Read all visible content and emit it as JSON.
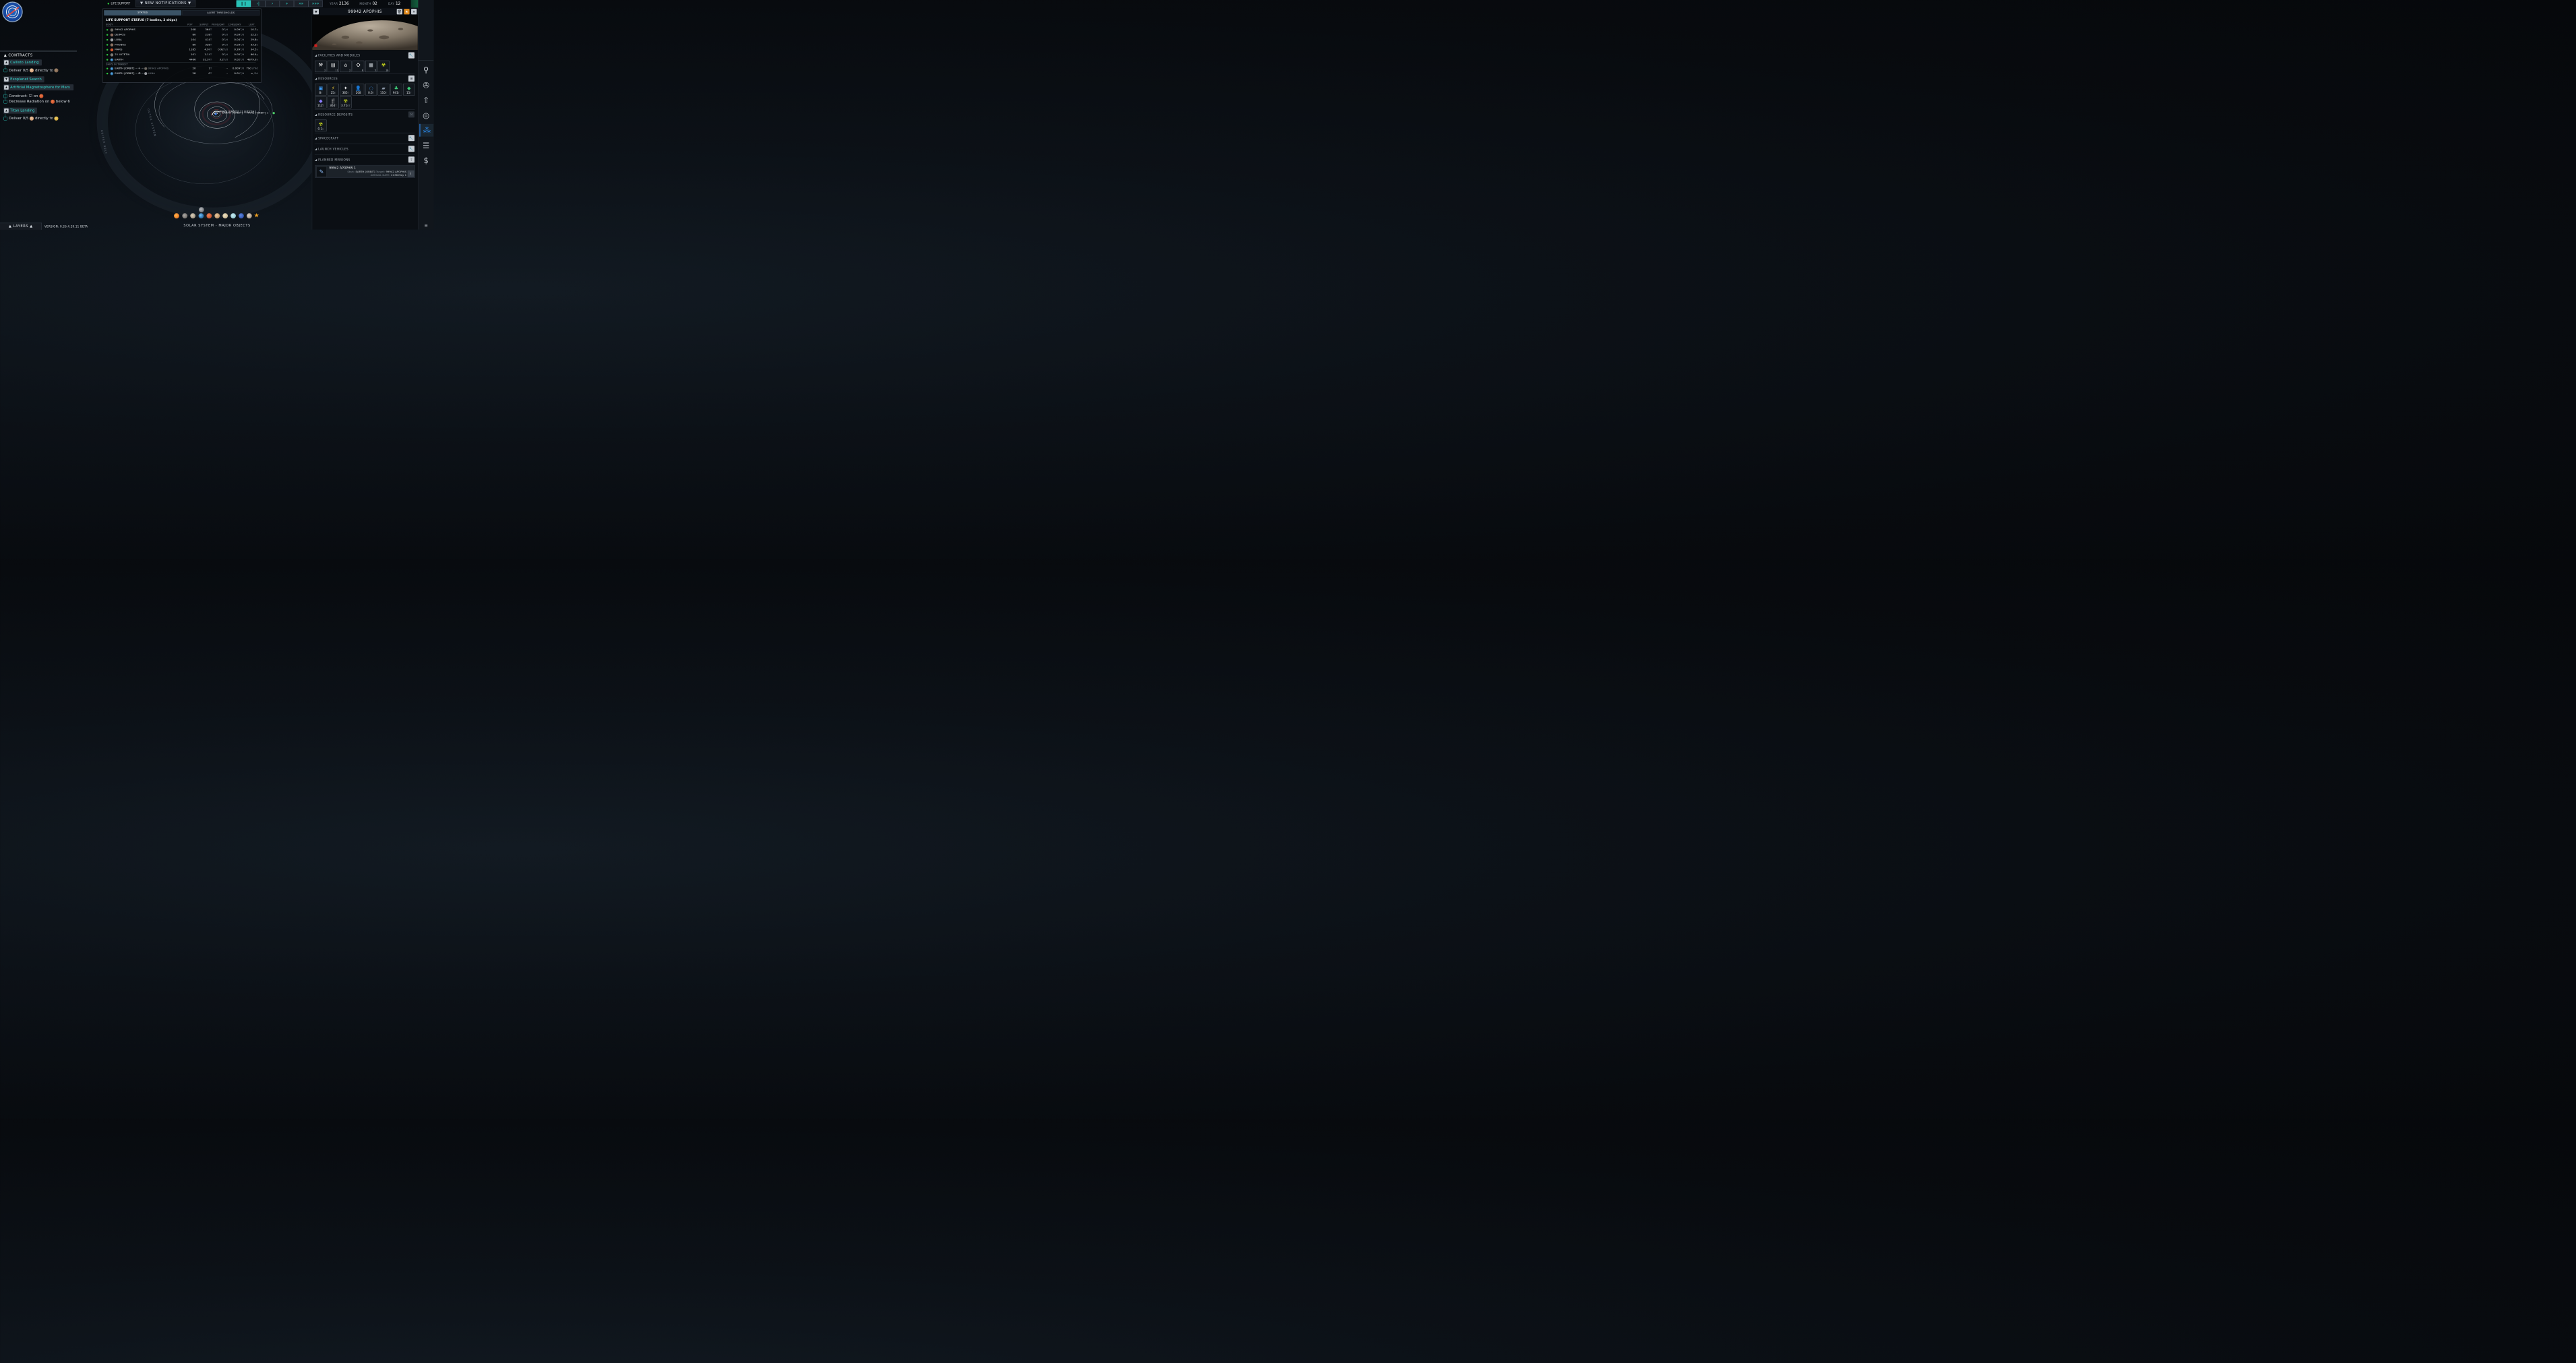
{
  "top_bar": {
    "life_support_label": "LIFE SUPPORT",
    "notifications_label": "▼ NEW NOTIFICATIONS ▼",
    "time_controls": [
      "❙❙",
      "›|",
      "›",
      "»",
      "»»",
      "»»»"
    ],
    "year_label": "YEAR",
    "year": "2136",
    "month_label": "MONTH",
    "month": "02",
    "day_label": "DAY",
    "day": "12",
    "money": "$126M"
  },
  "life_support": {
    "tabs": [
      "STATUS",
      "ALERT THRESHOLDS"
    ],
    "title": "LIFE SUPPORT STATUS  (7 bodies, 2 ships)",
    "columns": [
      "BODY",
      "POP",
      "SUPPLY",
      "PROD/DAY",
      "CONS/DAY",
      "LEFT"
    ],
    "bodies": [
      {
        "name": "99942 APOPHIS",
        "pop": "208",
        "supply": "364",
        "supply_unit": "T",
        "prod": "0",
        "prod_unit": "T/d",
        "cons": "0.09",
        "cons_unit": "T/d",
        "left": "10.7",
        "left_unit": "y"
      },
      {
        "name": "DEIMOS",
        "pop": "80",
        "supply": "218",
        "supply_unit": "T",
        "prod": "0",
        "prod_unit": "T/d",
        "cons": "0.03",
        "cons_unit": "T/d",
        "left": "22.2",
        "left_unit": "y"
      },
      {
        "name": "LUNA",
        "pop": "104",
        "supply": "414",
        "supply_unit": "T",
        "prod": "0",
        "prod_unit": "T/d",
        "cons": "0.04",
        "cons_unit": "T/d",
        "left": "29.8",
        "left_unit": "y"
      },
      {
        "name": "PHOBOS",
        "pop": "80",
        "supply": "328",
        "supply_unit": "T",
        "prod": "0",
        "prod_unit": "T/d",
        "cons": "0.03",
        "cons_unit": "T/d",
        "left": "33.5",
        "left_unit": "y"
      },
      {
        "name": "MARS",
        "pop": "1185",
        "supply": "4.9",
        "supply_unit": "KT",
        "prod": "0.92",
        "prod_unit": "T/d",
        "cons": "0.39",
        "cons_unit": "T/d",
        "left": "34.5",
        "left_unit": "y"
      },
      {
        "name": "21 LUTETIA",
        "pop": "101",
        "supply": "1.1",
        "supply_unit": "KT",
        "prod": "0",
        "prod_unit": "T/d",
        "cons": "0.05",
        "cons_unit": "T/d",
        "left": "66.4",
        "left_unit": "y"
      },
      {
        "name": "EARTH",
        "pop": "4466",
        "supply": "31.3",
        "supply_unit": "KT",
        "prod": "3.2",
        "prod_unit": "T/d",
        "cons": "0.02",
        "cons_unit": "T/d",
        "left": "4879.3",
        "left_unit": "y"
      }
    ],
    "ships_header": "SHIPS IN TRANSIT",
    "ships": [
      {
        "from": "EARTH [ORBIT]",
        "arrow1": "→",
        "arrow2": "→",
        "to": "99942 APOPHIS",
        "pop": "20",
        "supply": "1",
        "supply_unit": "T",
        "prod": "–",
        "cons": "0.009",
        "cons_unit": "T/d",
        "left": "79d",
        "left_sub": " /79d"
      },
      {
        "from": "EARTH [ORBIT]",
        "arrow1": "→",
        "arrow2": "→",
        "to": "LUNA",
        "pop": "28",
        "supply": "0",
        "supply_unit": "T",
        "prod": "–",
        "cons": "0.01",
        "cons_unit": "T/d",
        "left": "∞",
        "left_sub": " /3d"
      }
    ]
  },
  "contracts": {
    "title": "CONTRACTS",
    "items": [
      {
        "name": "Callisto Landing",
        "tasks": [
          "Deliver 0/5",
          "directly to"
        ]
      },
      {
        "name": "Exoplanet Search"
      },
      {
        "name": "Artificial Magnetosphere for Mars",
        "tasks": [
          "Construct:",
          "on",
          "Decrease Radiation on",
          "below 6"
        ]
      },
      {
        "name": "Titan Landing",
        "tasks": [
          "Deliver 0/5",
          "directly to"
        ]
      }
    ]
  },
  "map": {
    "label1": "MARS [ORBIT]1 21 LUTETIA 1",
    "label2": "EARTH [ORBIT] → MARS [ORBIT] 1",
    "kuiper": "KUIPER BELT",
    "outer": "OUTER SYSTEM"
  },
  "detail": {
    "title": "99942 APOPHIS",
    "sections": {
      "facilities": "FACILITIES AND MODULES",
      "resources": "RESOURCES",
      "deposits": "RESOURCE DEPOSITS",
      "spacecraft": "SPACECRAFT",
      "launch": "LAUNCH VEHICLES",
      "missions": "PLANNED MISSIONS"
    },
    "facilities": [
      {
        "icon": "drill-arm-icon",
        "count": "2"
      },
      {
        "icon": "hab-module-icon",
        "count": "11"
      },
      {
        "icon": "dome-icon",
        "count": "2"
      },
      {
        "icon": "refinery-icon",
        "count": "6"
      },
      {
        "icon": "solar-panel-icon",
        "count": "5"
      },
      {
        "icon": "reactor-tower-icon",
        "count": "16"
      }
    ],
    "resources": [
      {
        "icon": "chip-icon",
        "value": "8",
        "unit": "T",
        "color": "#3ea0ff"
      },
      {
        "icon": "energy-icon",
        "value": "25",
        "unit": "E",
        "color": "#ffd63a"
      },
      {
        "icon": "star-icon",
        "value": "365",
        "unit": "T",
        "color": "#ffffff"
      },
      {
        "icon": "person-icon",
        "value": "208",
        "unit": "",
        "color": "#e3b08a"
      },
      {
        "icon": "ring-icon",
        "value": "0.6",
        "unit": "T",
        "color": "#3ea0ff"
      },
      {
        "icon": "panel-icon",
        "value": "110",
        "unit": "T",
        "color": "#8a96a6"
      },
      {
        "icon": "cluster-icon",
        "value": "941",
        "unit": "T",
        "color": "#3fd07a"
      },
      {
        "icon": "gem-green-icon",
        "value": "15",
        "unit": "T",
        "color": "#3fd07a"
      },
      {
        "icon": "gem-purple-icon",
        "value": "112",
        "unit": "T",
        "color": "#8c7dff"
      },
      {
        "icon": "food-icon",
        "value": "364",
        "unit": "T",
        "color": "#dfe4e8"
      },
      {
        "icon": "radiation-icon",
        "value": "3.71",
        "unit": "KT",
        "color": "#d8e81c"
      }
    ],
    "deposit": {
      "icon": "radiation-icon",
      "value": "0.1",
      "unit": "x"
    },
    "mission": {
      "title": "99942 APOPHIS 1",
      "start_label": "Start:",
      "start": "EARTH [ORBIT]",
      "target_label": "Target:",
      "target": "99942 APOPHIS",
      "arrival_label": "ARRIVAL DATE:",
      "arrival": "2136 May 1"
    }
  },
  "bottom": {
    "layers": "▲ LAYERS ▲",
    "version": "VERSION: 0.26.4.29.11 BETA",
    "solar_system": "SOLAR SYSTEM - MAJOR OBJECTS"
  },
  "colors": {
    "accent": "#2fd2c7",
    "money": "#1da462",
    "ok": "#2ecc40",
    "active": "#2b8cf0"
  }
}
